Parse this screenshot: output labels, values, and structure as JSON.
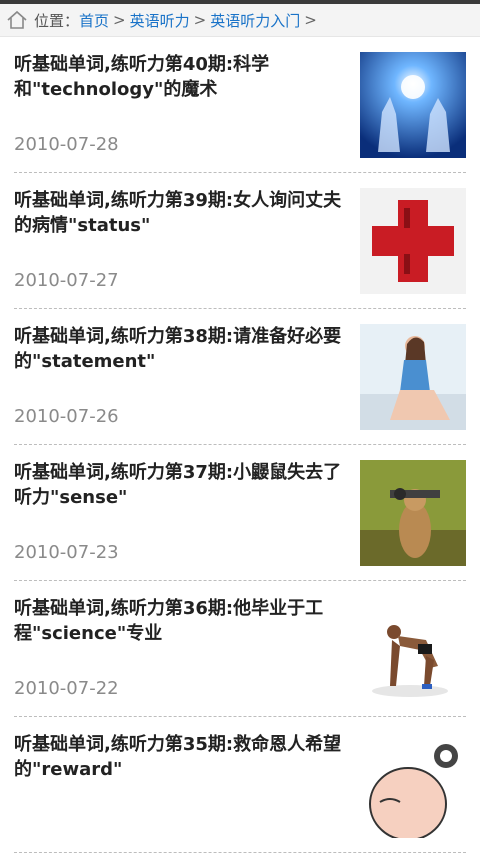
{
  "breadcrumb": {
    "prefix": "位置：",
    "links": [
      "首页",
      "英语听力",
      "英语听力入门"
    ],
    "separator": ">"
  },
  "articles": [
    {
      "title": "听基础单词,练听力第40期:科学和\"technology\"的魔术",
      "date": "2010-07-28",
      "thumb": "hands-light-image"
    },
    {
      "title": "听基础单词,练听力第39期:女人询问丈夫的病情\"status\"",
      "date": "2010-07-27",
      "thumb": "red-cross-image"
    },
    {
      "title": "听基础单词,练听力第38期:请准备好必要的\"statement\"",
      "date": "2010-07-26",
      "thumb": "woman-sitting-image"
    },
    {
      "title": "听基础单词,练听力第37期:小鼹鼠失去了听力\"sense\"",
      "date": "2010-07-23",
      "thumb": "gopher-image"
    },
    {
      "title": "听基础单词,练听力第36期:他毕业于工程\"science\"专业",
      "date": "2010-07-22",
      "thumb": "sprinter-image"
    },
    {
      "title": "听基础单词,练听力第35期:救命恩人希望的\"reward\"",
      "date": "",
      "thumb": "cartoon-face-image"
    }
  ]
}
